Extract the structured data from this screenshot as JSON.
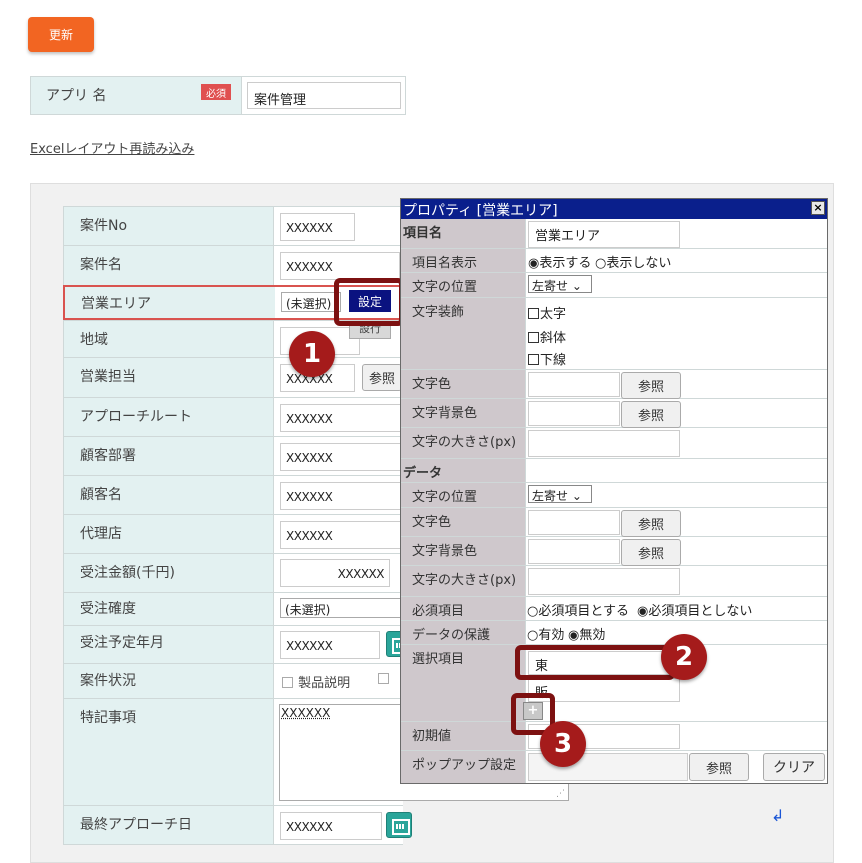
{
  "header": {
    "update_label": "更新"
  },
  "app": {
    "label": "アプリ 名",
    "required": "必須",
    "name_value": "案件管理"
  },
  "reload_link": "Excelレイアウト再読み込み",
  "form": {
    "rows": [
      {
        "label": "案件No",
        "value": "XXXXXX"
      },
      {
        "label": "案件名",
        "value": "XXXXXX"
      },
      {
        "label": "営業エリア",
        "value": "(未選択)",
        "setting_btn": "設定",
        "under_btn": "設行"
      },
      {
        "label": "地域",
        "value": ""
      },
      {
        "label": "営業担当",
        "value": "XXXXXX",
        "ref_btn": "参照"
      },
      {
        "label": "アプローチルート",
        "value": "XXXXXX"
      },
      {
        "label": "顧客部署",
        "value": "XXXXXX"
      },
      {
        "label": "顧客名",
        "value": "XXXXXX"
      },
      {
        "label": "代理店",
        "value": "XXXXXX"
      },
      {
        "label": "受注金額(千円)",
        "value": "XXXXXX"
      },
      {
        "label": "受注確度",
        "value": "(未選択)"
      },
      {
        "label": "受注予定年月",
        "value": "XXXXXX"
      },
      {
        "label": "案件状況",
        "value": "製品説明"
      },
      {
        "label": "特記事項",
        "value": "XXXXXX"
      },
      {
        "label": "最終アプローチ日",
        "value": "XXXXXX"
      }
    ]
  },
  "dialog": {
    "title": "プロパティ [営業エリア]",
    "close": "×",
    "item_section": "項目名",
    "item_name": "営業エリア",
    "item_display_label": "項目名表示",
    "item_display_opts": [
      "表示する",
      "表示しない"
    ],
    "text_pos_label": "文字の位置",
    "text_pos_value": "左寄せ",
    "decoration_label": "文字装飾",
    "decoration_opts": [
      "太字",
      "斜体",
      "下線"
    ],
    "color_label": "文字色",
    "bg_color_label": "文字背景色",
    "size_label": "文字の大きさ(px)",
    "ref_label": "参照",
    "data_section": "データ",
    "required_label": "必須項目",
    "required_opts": [
      "必須項目とする",
      "必須項目としない"
    ],
    "protect_label": "データの保護",
    "protect_opts": [
      "有効",
      "無効"
    ],
    "options_label": "選択項目",
    "options_values": [
      "東",
      "販"
    ],
    "initial_label": "初期値",
    "popup_label": "ポップアップ設定",
    "clear_label": "クリア"
  },
  "callouts": [
    "1",
    "2",
    "3"
  ],
  "colors": {
    "accent": "#f26522",
    "label_bg": "#e3f1f1",
    "dialog_title": "#0a1f8c",
    "callout": "#a51b1b"
  }
}
